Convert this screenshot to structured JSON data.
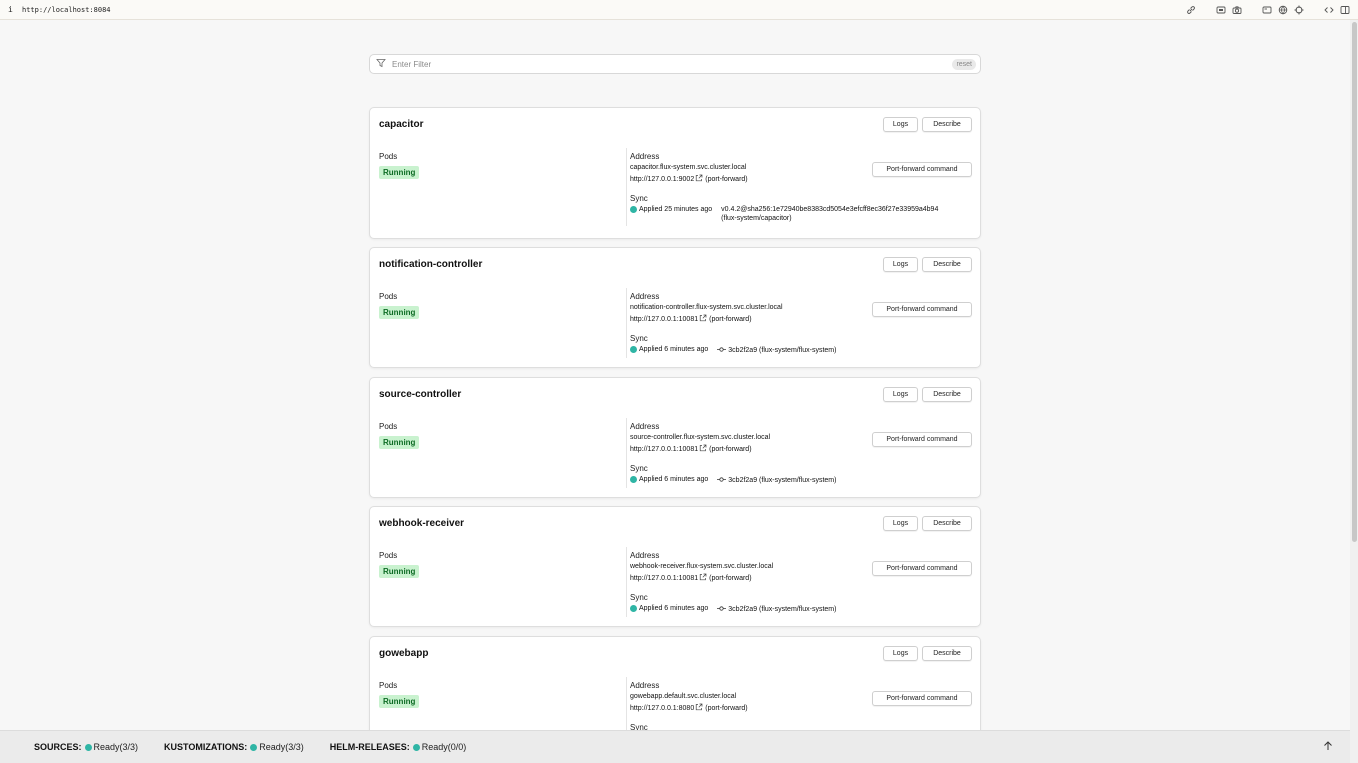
{
  "browser": {
    "info_glyph": "i",
    "url": "http://localhost:8084"
  },
  "filter": {
    "placeholder": "Enter Filter",
    "reset_label": "reset"
  },
  "labels": {
    "logs": "Logs",
    "describe": "Describe",
    "port_forward": "Port-forward command",
    "pods": "Pods",
    "address": "Address",
    "sync": "Sync",
    "port_forward_note": "(port-forward)"
  },
  "services": [
    {
      "name": "capacitor",
      "status": "Running",
      "host": "capacitor.flux-system.svc.cluster.local",
      "url": "http://127.0.0.1:9002",
      "applied": "Applied 25 minutes ago",
      "revision": "v0.4.2@sha256:1e72940be8383cd5054e3efcff8ec36f27e33959a4b94",
      "source": "(flux-system/capacitor)"
    },
    {
      "name": "notification-controller",
      "status": "Running",
      "host": "notification-controller.flux-system.svc.cluster.local",
      "url": "http://127.0.0.1:10081",
      "applied": "Applied 6 minutes ago",
      "revision": "3cb2f2a9",
      "source": "(flux-system/flux-system)"
    },
    {
      "name": "source-controller",
      "status": "Running",
      "host": "source-controller.flux-system.svc.cluster.local",
      "url": "http://127.0.0.1:10081",
      "applied": "Applied 6 minutes ago",
      "revision": "3cb2f2a9",
      "source": "(flux-system/flux-system)"
    },
    {
      "name": "webhook-receiver",
      "status": "Running",
      "host": "webhook-receiver.flux-system.svc.cluster.local",
      "url": "http://127.0.0.1:10081",
      "applied": "Applied 6 minutes ago",
      "revision": "3cb2f2a9",
      "source": "(flux-system/flux-system)"
    },
    {
      "name": "gowebapp",
      "status": "Running",
      "host": "gowebapp.default.svc.cluster.local",
      "url": "http://127.0.0.1:8080",
      "applied": "",
      "revision": "",
      "source": ""
    }
  ],
  "footer": {
    "sources_label": "SOURCES:",
    "sources_value": "Ready(3/3)",
    "kustomizations_label": "KUSTOMIZATIONS:",
    "kustomizations_value": "Ready(3/3)",
    "helm_label": "HELM-RELEASES:",
    "helm_value": "Ready(0/0)"
  },
  "colors": {
    "ready_dot": "#2fb5a5",
    "running_bg": "#c9f2cf",
    "running_text": "#0d6b24"
  }
}
